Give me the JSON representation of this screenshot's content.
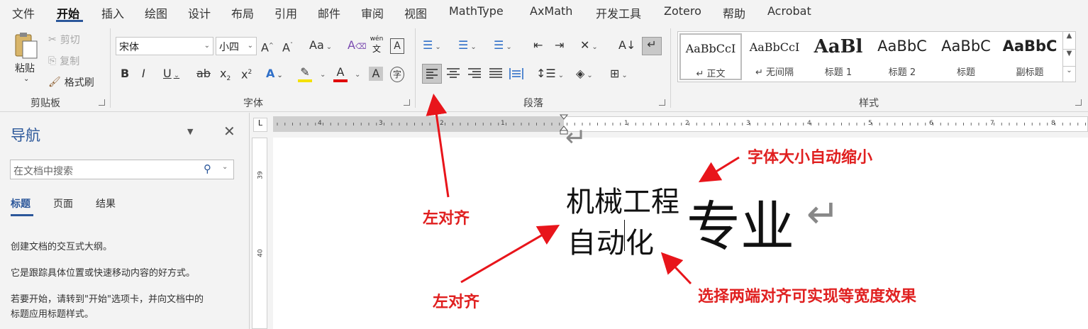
{
  "menu": {
    "tabs": [
      "文件",
      "开始",
      "插入",
      "绘图",
      "设计",
      "布局",
      "引用",
      "邮件",
      "审阅",
      "视图",
      "MathType",
      "AxMath",
      "开发工具",
      "Zotero",
      "帮助",
      "Acrobat"
    ],
    "active": "开始"
  },
  "ribbon": {
    "clipboard": {
      "paste": "粘贴",
      "cut": "剪切",
      "copy": "复制",
      "format_painter": "格式刷",
      "label": "剪贴板"
    },
    "font": {
      "name": "宋体",
      "size": "小四",
      "label": "字体",
      "grow": "A^",
      "shrink": "Aˇ",
      "change_case": "Aa",
      "phonetic": "wén",
      "phonetic_char": "文"
    },
    "paragraph": {
      "label": "段落"
    },
    "styles": {
      "label": "样式",
      "items": [
        {
          "sample": "AaBbCcI",
          "name": "↵ 正文"
        },
        {
          "sample": "AaBbCcI",
          "name": "↵ 无间隔"
        },
        {
          "sample": "AaBl",
          "name": "标题 1"
        },
        {
          "sample": "AaBbC",
          "name": "标题 2"
        },
        {
          "sample": "AaBbC",
          "name": "标题"
        },
        {
          "sample": "AaBbC",
          "name": "副标题"
        }
      ]
    }
  },
  "nav": {
    "title": "导航",
    "search_placeholder": "在文档中搜索",
    "tabs": [
      "标题",
      "页面",
      "结果"
    ],
    "p1": "创建文档的交互式大纲。",
    "p2": "它是跟踪具体位置或快速移动内容的好方式。",
    "p3a": "若要开始，请转到\"开始\"选项卡，并向文档中的",
    "p3b": "标题应用标题样式。"
  },
  "ruler": {
    "h_left": [
      "4",
      "3",
      "2",
      "1"
    ],
    "h_right": [
      "1",
      "2",
      "3",
      "4",
      "5",
      "6",
      "7",
      "8"
    ],
    "v": [
      "39",
      "40"
    ]
  },
  "document": {
    "line1": "机械工程",
    "line2": "自动化",
    "big": "专业",
    "mark": "↵"
  },
  "annotations": {
    "font_shrink": "字体大小自动缩小",
    "left_align_1": "左对齐",
    "left_align_2": "左对齐",
    "justify": "选择两端对齐可实现等宽度效果"
  }
}
